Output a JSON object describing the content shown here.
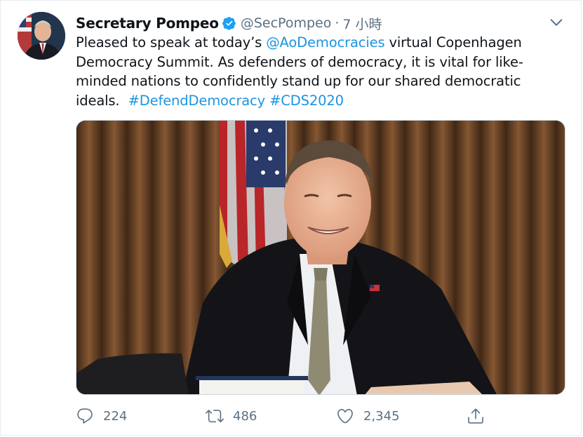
{
  "tweet": {
    "author_name": "Secretary Pompeo",
    "handle": "@SecPompeo",
    "separator": "·",
    "time": "7 小時",
    "text_lines": [
      {
        "before": "Pleased to speak at today’s ",
        "mention": "@AoDemocracies",
        "after": " virtual Copenhagen"
      },
      {
        "text": "Democracy Summit. As defenders of democracy, it is vital for like-"
      },
      {
        "text": "minded nations to confidently stand up for our shared democratic"
      },
      {
        "before": "ideals.  ",
        "hashtag1": "#DefendDemocracy",
        "space": " ",
        "hashtag2": "#CDS2020"
      }
    ]
  },
  "actions": {
    "reply_count": "224",
    "retweet_count": "486",
    "like_count": "2,345"
  },
  "icons": {
    "verified": "verified-badge-icon",
    "caret": "chevron-down-icon",
    "reply": "reply-icon",
    "retweet": "retweet-icon",
    "like": "heart-icon",
    "share": "share-icon"
  },
  "colors": {
    "link": "#1b95e0",
    "muted": "#5b7083",
    "verified": "#1da1f2"
  }
}
